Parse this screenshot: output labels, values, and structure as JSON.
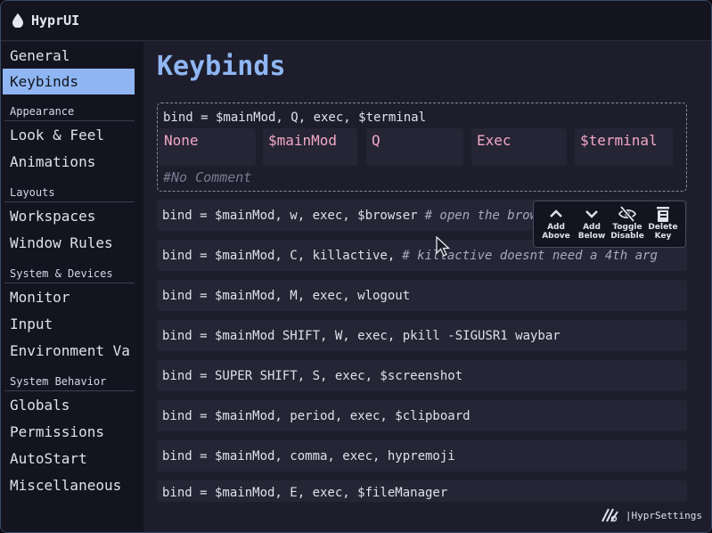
{
  "app": {
    "title": "HyprUI",
    "icon": "droplet-icon"
  },
  "sidebar": {
    "items": [
      {
        "label": "General",
        "active": false
      },
      {
        "label": "Keybinds",
        "active": true
      }
    ],
    "sections": [
      {
        "title": "Appearance",
        "items": [
          {
            "label": "Look & Feel"
          },
          {
            "label": "Animations"
          }
        ]
      },
      {
        "title": "Layouts",
        "items": [
          {
            "label": "Workspaces"
          },
          {
            "label": "Window Rules"
          }
        ]
      },
      {
        "title": "System & Devices",
        "items": [
          {
            "label": "Monitor"
          },
          {
            "label": "Input"
          },
          {
            "label": "Environment Va"
          }
        ]
      },
      {
        "title": "System Behavior",
        "items": [
          {
            "label": "Globals"
          },
          {
            "label": "Permissions"
          },
          {
            "label": "AutoStart"
          },
          {
            "label": "Miscellaneous"
          }
        ]
      }
    ]
  },
  "main": {
    "title": "Keybinds",
    "expanded": {
      "raw": "bind = $mainMod, Q, exec, $terminal",
      "fields": [
        "None",
        "$mainMod",
        "Q",
        "Exec",
        "$terminal"
      ],
      "comment": "#No Comment"
    },
    "binds": [
      {
        "text": "bind = $mainMod, w, exec, $browser",
        "comment": "# open the browser"
      },
      {
        "text": "bind = $mainMod, C, killactive,",
        "comment": "# killactive doesnt need a 4th arg"
      },
      {
        "text": "bind = $mainMod, M, exec, wlogout",
        "comment": ""
      },
      {
        "text": "bind = $mainMod SHIFT, W, exec, pkill -SIGUSR1 waybar",
        "comment": ""
      },
      {
        "text": "bind = SUPER SHIFT, S, exec, $screenshot",
        "comment": ""
      },
      {
        "text": "bind = $mainMod, period, exec, $clipboard",
        "comment": ""
      },
      {
        "text": "bind = $mainMod, comma, exec, hypremoji",
        "comment": ""
      },
      {
        "text": "bind = $mainMod, E, exec, $fileManager",
        "comment": ""
      }
    ],
    "popup": {
      "add_above": [
        "Add",
        "Above"
      ],
      "add_below": [
        "Add",
        "Below"
      ],
      "toggle_disable": [
        "Toggle",
        "Disable"
      ],
      "delete_key": [
        "Delete",
        "Key"
      ]
    }
  },
  "footer": {
    "text": "|HyprSettings",
    "icon": "hyprsettings-logo-icon"
  },
  "colors": {
    "accent": "#8fb6f2",
    "field_text": "#f2a8c6",
    "background": "#1d1d2c",
    "sidebar": "#141420",
    "row": "#252535"
  }
}
